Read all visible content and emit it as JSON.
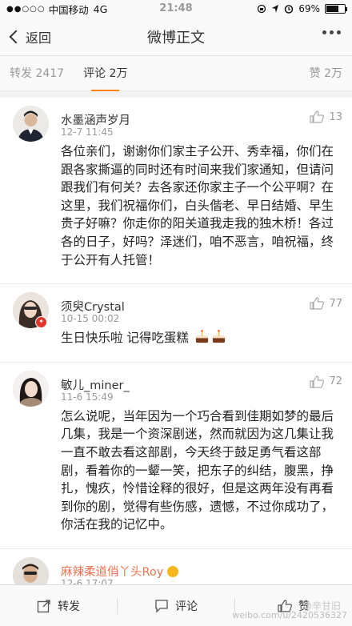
{
  "status_bar": {
    "signal": "●●○○○",
    "carrier": "中国移动",
    "network": "4G",
    "time": "21:48",
    "battery": "69%",
    "battery_level": 0.69
  },
  "nav": {
    "back_label": "返回",
    "title": "微博正文"
  },
  "tabs": {
    "repost": "转发 2417",
    "comment": "评论 2万",
    "like": "赞 2万"
  },
  "comments": [
    {
      "user": "水墨涵声岁月",
      "time": "12-7 11:45",
      "likes": "13",
      "text": "各位亲们，谢谢你们家主子公开、秀幸福，你们在跟各家撕逼的同时还有时间来我们家通知，但请问跟我们有何关？去各家还你家主子一个公平啊？在这里，我们祝福你们，白头偕老、早日结婚、早生贵子好嘛？你走你的阳关道我走我的独木桥！各过各的日子，好吗？泽迷们，咱不恶言，咱祝福，终于公开有人托管！"
    },
    {
      "user": "须臾Crystal",
      "time": "10-15 00:02",
      "likes": "77",
      "text": "生日快乐啦 记得吃蛋糕"
    },
    {
      "user": "敏儿_miner_",
      "time": "11-6 15:49",
      "likes": "72",
      "text": "怎么说呢，当年因为一个巧合看到佳期如梦的最后几集，我是一个资深剧迷，然而就因为这几集让我一直不敢去看这部剧，今天终于鼓足勇气看这部剧，看着你的一颦一笑，把东子的纠结，腹黑，挣扎，愧疚，怜惜诠释的很好，但是这两年没有再看到你的剧，觉得有些伤感，遗憾，不过你成功了，你活在我的记忆中。"
    },
    {
      "user": "麻辣柔道俏丫头Roy",
      "time": "12-6 17:07",
      "likes": "",
      "text": ""
    }
  ],
  "bottom_bar": {
    "repost_label": "转发",
    "comment_label": "评论",
    "like_label": "赞"
  },
  "watermark": {
    "name": "@辛甘旧",
    "url": "weibo.com/u/2420536327"
  },
  "colors": {
    "accent": "#ff8200",
    "username_orange": "#eb7350"
  },
  "icons": [
    "thumb-up-icon",
    "repost-icon",
    "comment-icon",
    "cake-icon",
    "verified-badge-icon"
  ]
}
